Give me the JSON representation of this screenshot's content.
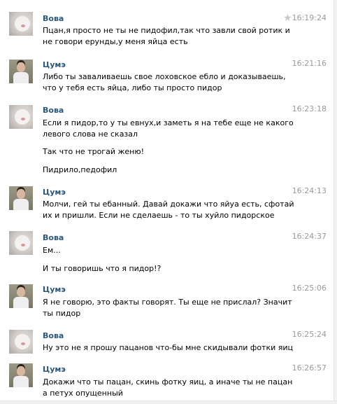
{
  "top_fragment": "",
  "messages": [
    {
      "author": "Вова",
      "time": "16:19:24",
      "avatar": "cat",
      "starred": true,
      "lines": [
        "Пцан,я просто не ты не пидофил,так что завли свой ротик и не говори ерунды,у меня яйца есть"
      ]
    },
    {
      "author": "Цумэ",
      "time": "16:21:16",
      "avatar": "man",
      "lines": [
        "Либо ты заваливаешь свое лоховское ебло и доказываешь, что у тебя есть яйца, либо ты просто пидор"
      ]
    },
    {
      "author": "Вова",
      "time": "16:23:18",
      "avatar": "cat",
      "lines": [
        "Если я пидор,то у ты евнух,и заметь я на тебе еще не какого левого слова не сказал",
        "Так что не трогай женю!",
        "Пидрило,педофил"
      ]
    },
    {
      "author": "Цумэ",
      "time": "16:24:13",
      "avatar": "man",
      "lines": [
        "Молчи, гей ты ебанный. Давай докажи что яйуа есть, сфотай их и пришли. Если не сделаешь - то ты хуйло пидорское"
      ]
    },
    {
      "author": "Вова",
      "time": "16:24:37",
      "avatar": "cat",
      "lines": [
        "Ем...",
        "И ты говоришь что я пидор!?"
      ]
    },
    {
      "author": "Цумэ",
      "time": "16:25:06",
      "avatar": "man",
      "lines": [
        "Я не говорю, это факты говорят. Ты еще не прислал? Значит ты пидор"
      ]
    },
    {
      "author": "Вова",
      "time": "16:25:24",
      "avatar": "cat",
      "lines": [
        "Ну это не я прошу пацанов что-бы мне скидывали фотки яиц"
      ]
    },
    {
      "author": "Цумэ",
      "time": "16:26:57",
      "avatar": "man",
      "lines": [
        "Докажи что ты пацан, скинь фотку яиц, а иначе ты не пацан а петух опущенный"
      ]
    }
  ],
  "star_icon": "star-icon"
}
